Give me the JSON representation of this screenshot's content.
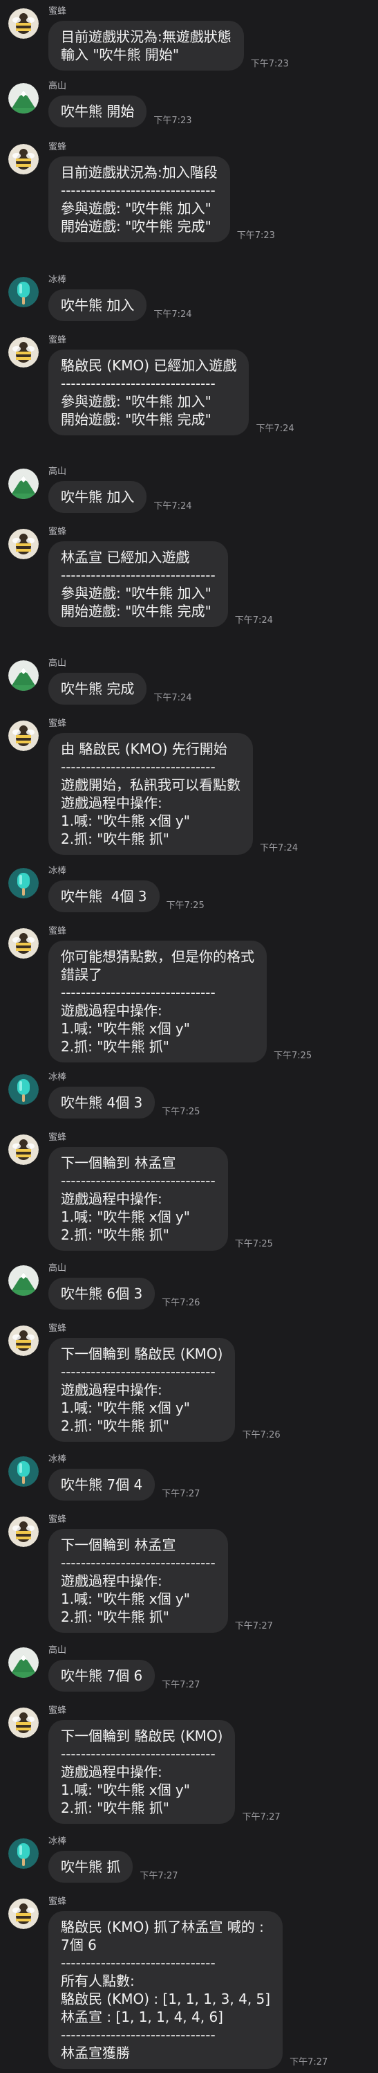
{
  "messages": [
    {
      "sender": "蜜蜂",
      "avatar": "bee-avatar",
      "text": "目前遊戲狀況為:無遊戲狀態\n輸入 \"吹牛熊 開始\"",
      "time": "下午7:23"
    },
    {
      "sender": "高山",
      "avatar": "mountain-avatar",
      "text": "吹牛熊 開始",
      "time": "下午7:23"
    },
    {
      "sender": "蜜蜂",
      "avatar": "bee-avatar",
      "text": "目前遊戲狀況為:加入階段\n-------------------------------\n參與遊戲: \"吹牛熊 加入\"\n開始遊戲: \"吹牛熊 完成\"",
      "time": "下午7:23"
    },
    {
      "sender": "冰棒",
      "avatar": "popsicle-avatar",
      "text": "吹牛熊 加入",
      "time": "下午7:24"
    },
    {
      "sender": "蜜蜂",
      "avatar": "bee-avatar",
      "text": "駱啟民 (KMO) 已經加入遊戲\n-------------------------------\n參與遊戲: \"吹牛熊 加入\"\n開始遊戲: \"吹牛熊 完成\"",
      "time": "下午7:24"
    },
    {
      "sender": "高山",
      "avatar": "mountain-avatar",
      "text": "吹牛熊 加入",
      "time": "下午7:24"
    },
    {
      "sender": "蜜蜂",
      "avatar": "bee-avatar",
      "text": "林孟宣 已經加入遊戲\n-------------------------------\n參與遊戲: \"吹牛熊 加入\"\n開始遊戲: \"吹牛熊 完成\"",
      "time": "下午7:24"
    },
    {
      "sender": "高山",
      "avatar": "mountain-avatar",
      "text": "吹牛熊 完成",
      "time": "下午7:24"
    },
    {
      "sender": "蜜蜂",
      "avatar": "bee-avatar",
      "text": "由 駱啟民 (KMO) 先行開始\n-------------------------------\n遊戲開始，私訊我可以看點數\n遊戲過程中操作:\n1.喊: \"吹牛熊 x個 y\"\n2.抓: \"吹牛熊 抓\"",
      "time": "下午7:24"
    },
    {
      "sender": "冰棒",
      "avatar": "popsicle-avatar",
      "text": "吹牛熊  4個 3",
      "time": "下午7:25"
    },
    {
      "sender": "蜜蜂",
      "avatar": "bee-avatar",
      "text": "你可能想猜點數，但是你的格式\n錯誤了\n-------------------------------\n遊戲過程中操作:\n1.喊: \"吹牛熊 x個 y\"\n2.抓: \"吹牛熊 抓\"",
      "time": "下午7:25"
    },
    {
      "sender": "冰棒",
      "avatar": "popsicle-avatar",
      "text": "吹牛熊 4個 3",
      "time": "下午7:25"
    },
    {
      "sender": "蜜蜂",
      "avatar": "bee-avatar",
      "text": "下一個輪到 林孟宣\n-------------------------------\n遊戲過程中操作:\n1.喊: \"吹牛熊 x個 y\"\n2.抓: \"吹牛熊 抓\"",
      "time": "下午7:25"
    },
    {
      "sender": "高山",
      "avatar": "mountain-avatar",
      "text": "吹牛熊 6個 3",
      "time": "下午7:26"
    },
    {
      "sender": "蜜蜂",
      "avatar": "bee-avatar",
      "text": "下一個輪到 駱啟民 (KMO)\n-------------------------------\n遊戲過程中操作:\n1.喊: \"吹牛熊 x個 y\"\n2.抓: \"吹牛熊 抓\"",
      "time": "下午7:26"
    },
    {
      "sender": "冰棒",
      "avatar": "popsicle-avatar",
      "text": "吹牛熊 7個 4",
      "time": "下午7:27"
    },
    {
      "sender": "蜜蜂",
      "avatar": "bee-avatar",
      "text": "下一個輪到 林孟宣\n-------------------------------\n遊戲過程中操作:\n1.喊: \"吹牛熊 x個 y\"\n2.抓: \"吹牛熊 抓\"",
      "time": "下午7:27"
    },
    {
      "sender": "高山",
      "avatar": "mountain-avatar",
      "text": "吹牛熊 7個 6",
      "time": "下午7:27"
    },
    {
      "sender": "蜜蜂",
      "avatar": "bee-avatar",
      "text": "下一個輪到 駱啟民 (KMO)\n-------------------------------\n遊戲過程中操作:\n1.喊: \"吹牛熊 x個 y\"\n2.抓: \"吹牛熊 抓\"",
      "time": "下午7:27"
    },
    {
      "sender": "冰棒",
      "avatar": "popsicle-avatar",
      "text": "吹牛熊 抓",
      "time": "下午7:27"
    },
    {
      "sender": "蜜蜂",
      "avatar": "bee-avatar",
      "text": "駱啟民 (KMO) 抓了林孟宣 喊的 :\n7個 6\n-------------------------------\n所有人點數:\n駱啟民 (KMO) : [1, 1, 1, 3, 4, 5]\n林孟宣 : [1, 1, 1, 4, 4, 6]\n-------------------------------\n林孟宣獲勝",
      "time": "下午7:27"
    }
  ]
}
